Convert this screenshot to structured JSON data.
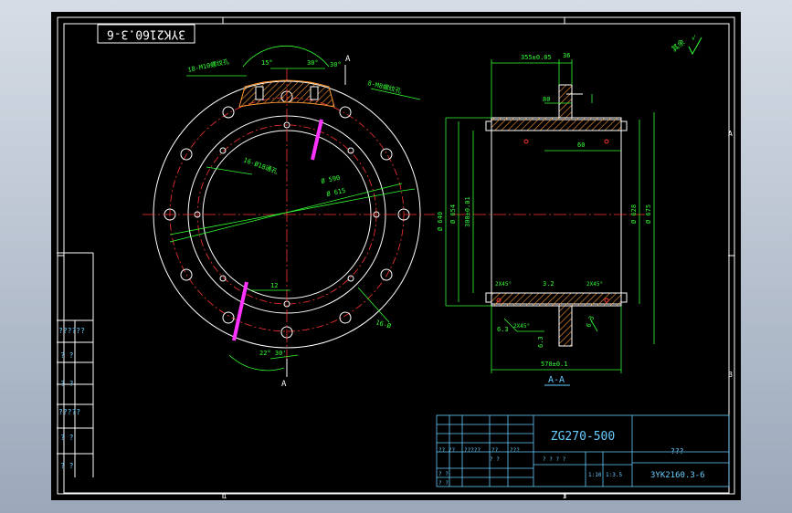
{
  "drawing_number_rotated": "3YK2160.3-6",
  "section_label": "A-A",
  "cut_label": "A",
  "title_block": {
    "material": "ZG270-500",
    "part_name": "???",
    "drawing_number": "3YK2160.3-6",
    "scale_values": [
      "1:10",
      "1:3.5"
    ],
    "row_labels": [
      "?? ??",
      "?????",
      "??",
      "???"
    ]
  },
  "left_strip": {
    "labels": [
      "??????",
      "?  ?",
      "?  ?",
      "?????",
      "?  ?",
      "?  ?"
    ]
  },
  "border_marks": {
    "top": "A",
    "side": "B",
    "left": "1",
    "right": "3"
  },
  "roughness_note": "√",
  "annotations": {
    "top_left_note": "18-M10螺纹孔",
    "top_right_note": "8-M8螺纹孔",
    "mid_note": "16-Ø18通孔",
    "bottom_right_note": "16-Ø",
    "angle_1": "15°",
    "angle_2": "30°",
    "angle_3": "30°",
    "angle_4": "22° 30'",
    "dia_1": "Ø 590",
    "dia_2": "Ø 615",
    "dim_12": "12",
    "dim_top": "355±0.05",
    "dim_36": "36",
    "dim_80": "80",
    "dim_60": "60",
    "dim_bot": "570±0.1",
    "dim_32": "3.2",
    "dim_left_1": "Ø 640",
    "dim_left_2": "Ø 654",
    "dim_left_3": "300±0.01",
    "dim_right_1": "Ø 628",
    "dim_right_2": "Ø 675",
    "chamfer_1": "2X45°",
    "chamfer_2": "2X45°",
    "chamfer_3": "2X45°",
    "small_1": "6.3",
    "small_2": "6.3",
    "small_3": "6.3"
  }
}
